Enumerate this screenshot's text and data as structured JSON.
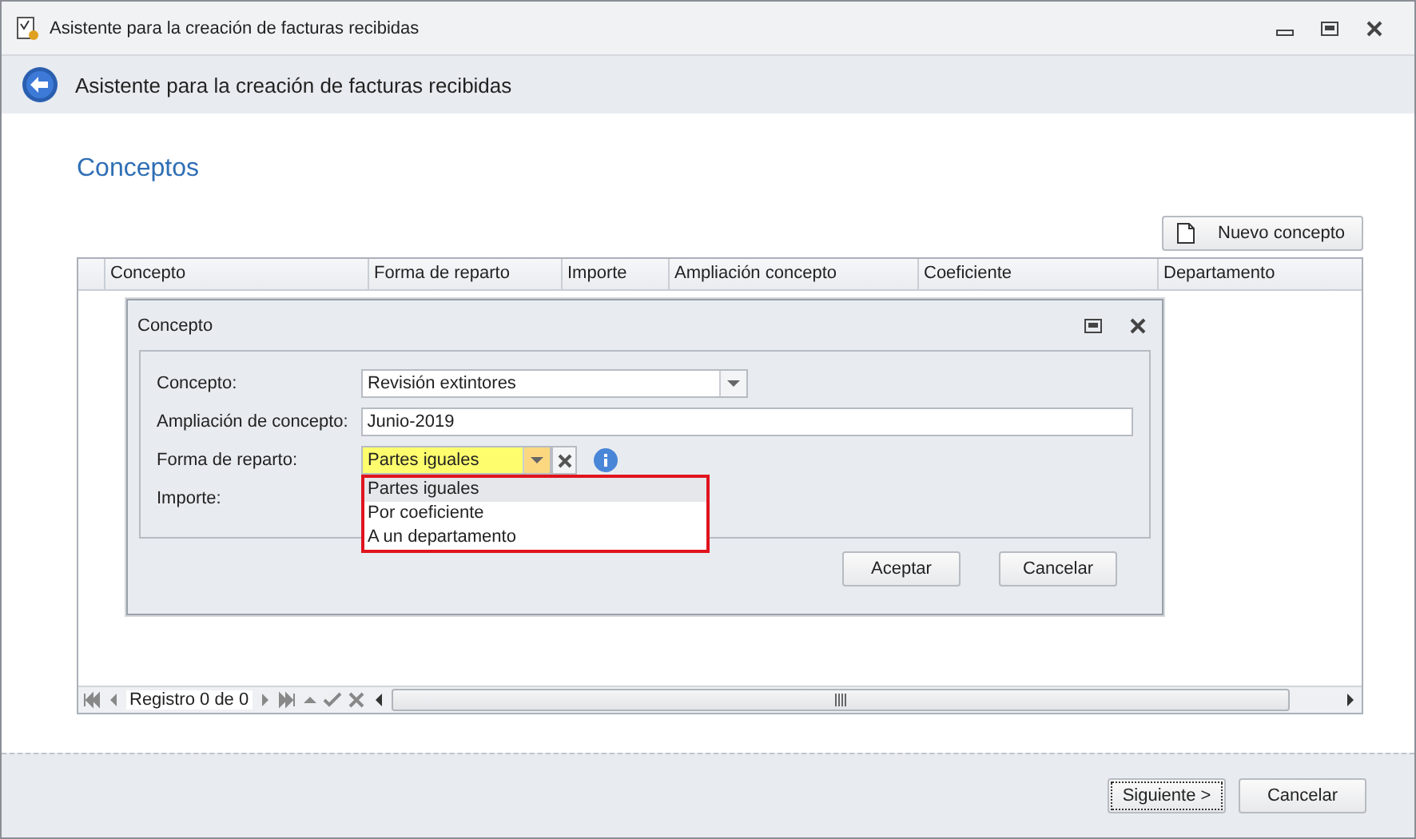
{
  "window": {
    "title": "Asistente para la creación de facturas recibidas"
  },
  "header": {
    "title": "Asistente para la creación de facturas recibidas"
  },
  "section_title": "Conceptos",
  "new_button": "Nuevo concepto",
  "table": {
    "columns": [
      "Concepto",
      "Forma de reparto",
      "Importe",
      "Ampliación concepto",
      "Coeficiente",
      "Departamento"
    ]
  },
  "navigator": {
    "record_text": "Registro 0 de 0"
  },
  "dialog": {
    "title": "Concepto",
    "concepto": {
      "label": "Concepto:",
      "value": "Revisión extintores"
    },
    "ampliacion": {
      "label": "Ampliación de concepto:",
      "value": "Junio-2019"
    },
    "forma": {
      "label": "Forma de reparto:",
      "value": "Partes iguales",
      "expanded": true,
      "options": [
        {
          "label": "Partes iguales",
          "selected": true
        },
        {
          "label": "Por coeficiente",
          "selected": false
        },
        {
          "label": "A un departamento",
          "selected": false
        }
      ]
    },
    "importe": {
      "label": "Importe:"
    },
    "buttons": [
      "Aceptar",
      "Cancelar"
    ]
  },
  "footer_buttons": [
    {
      "label": "Siguiente >",
      "focused": true
    },
    {
      "label": "Cancelar",
      "focused": false
    }
  ]
}
